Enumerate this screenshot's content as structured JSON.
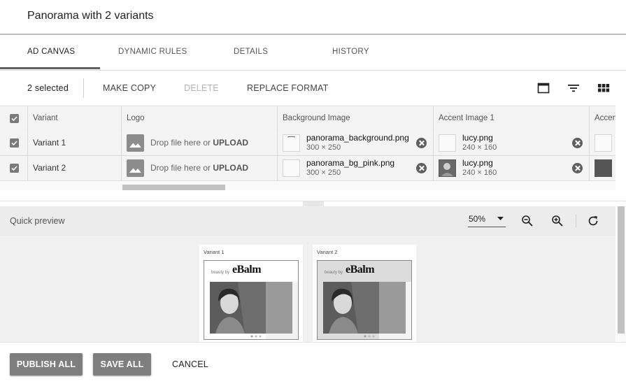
{
  "title": "Panorama with 2 variants",
  "tabs": [
    {
      "label": "AD CANVAS",
      "active": true
    },
    {
      "label": "DYNAMIC RULES"
    },
    {
      "label": "DETAILS"
    },
    {
      "label": "HISTORY"
    }
  ],
  "toolbar": {
    "selected": "2 selected",
    "make_copy": "MAKE COPY",
    "delete": "DELETE",
    "replace_format": "REPLACE FORMAT",
    "icons": [
      "window-icon",
      "filter-icon",
      "grid-view-icon"
    ]
  },
  "table": {
    "headers": [
      "Variant",
      "Logo",
      "Background Image",
      "Accent Image 1",
      "Accen"
    ],
    "rows": [
      {
        "variant": "Variant 1",
        "logo_prefix": "Drop file here or",
        "logo_link": "UPLOAD",
        "bg_name": "panorama_background.png",
        "bg_size": "300 × 250",
        "accent_name": "lucy.png",
        "accent_size": "240 × 160"
      },
      {
        "variant": "Variant 2",
        "logo_prefix": "Drop file here or",
        "logo_link": "UPLOAD",
        "bg_name": "panorama_bg_pink.png",
        "bg_size": "300 × 250",
        "accent_name": "lucy.png",
        "accent_size": "240 × 160"
      }
    ]
  },
  "preview": {
    "label": "Quick preview",
    "zoom": "50%",
    "cards": [
      {
        "label": "Variant 1",
        "beauty": "beauty by",
        "brand": "eBalm"
      },
      {
        "label": "Variant 2",
        "beauty": "beauty by",
        "brand": "eBalm"
      }
    ]
  },
  "footer": {
    "publish_all": "PUBLISH ALL",
    "save_all": "SAVE ALL",
    "cancel": "CANCEL"
  }
}
